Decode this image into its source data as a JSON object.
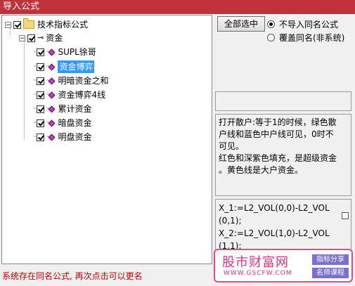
{
  "window": {
    "title": "导入公式"
  },
  "tree": {
    "root_label": "技术指标公式",
    "group_label": "资金",
    "items": [
      {
        "label": "SUPL徐哥"
      },
      {
        "label": "资金博弈"
      },
      {
        "label": "明暗资金之和"
      },
      {
        "label": "资金博弈4线"
      },
      {
        "label": "累计资金"
      },
      {
        "label": "暗盘资金"
      },
      {
        "label": "明盘资金"
      }
    ],
    "expander_symbol": "−"
  },
  "actions": {
    "select_all_label": "全部选中"
  },
  "options": {
    "no_import_same_name": "不导入同名公式",
    "overwrite_same_name": "覆盖同名(非系统)",
    "selected": "no_import_same_name"
  },
  "description": {
    "line1": "打开散户:等于1的时候，绿色散",
    "line2": "户线和蓝色中户线可见，0时不",
    "line3": "可见。",
    "line4": "红色和深紫色填充，是超级资金",
    "line5": "。黄色线是大户资金。"
  },
  "code": {
    "line1": "X_1:=L2_VOL(0,0)-L2_VOL",
    "line2": "(0,1);",
    "line3": "X_2:=L2_VOL(1,0)-L2_VOL",
    "line4": "(1,1);"
  },
  "status": {
    "text": "系统存在同名公式, 再次点击可以更名"
  },
  "watermark": {
    "main": "股市财富网",
    "url": "WWW.GSCFW.COM",
    "tag1": "指标分享",
    "tag2": "名师课程",
    "accent": "#e0308a",
    "tag_color": "#7b6fd1"
  },
  "colors": {
    "titlebar": "#c0323a",
    "selection": "#3399ff",
    "status_text": "#c00000",
    "formula_icon": "#c040c0"
  }
}
